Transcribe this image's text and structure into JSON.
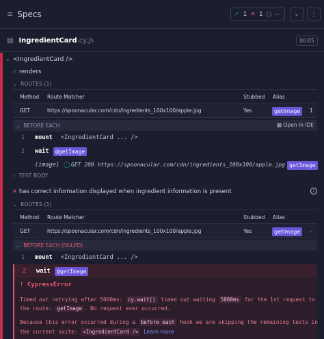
{
  "header": {
    "title": "Specs",
    "stats": {
      "passed": "1",
      "failed": "1",
      "pending": "--"
    }
  },
  "file": {
    "name": "IngredientCard",
    "ext": ".cy.js",
    "duration": "00:05"
  },
  "suite": {
    "title": "<IngredientCard />"
  },
  "test1": {
    "title": "renders",
    "routes_header": "ROUTES (1)",
    "routes_columns": {
      "method": "Method",
      "matcher": "Route Matcher",
      "stubbed": "Stubbed",
      "alias": "Alias"
    },
    "route": {
      "method": "GET",
      "matcher": "https://spoonacular.com/cdn/ingredients_100x100/apple.jpg",
      "stubbed": "Yes",
      "alias": "getImage",
      "count": "1"
    },
    "before_each_header": "BEFORE EACH",
    "open_in_ide": "Open in IDE",
    "commands": [
      {
        "idx": "1",
        "name": "mount",
        "msg": "<IngredientCard ... />"
      },
      {
        "idx": "2",
        "name": "wait",
        "alias": "@getImage"
      }
    ],
    "image_log": {
      "label": "(image)",
      "msg": "GET 200 https://spoonacular.com/cdn/ingredients_100x100/apple.jpg",
      "alias": "getImage"
    },
    "test_body_header": "TEST BODY"
  },
  "test2": {
    "title": "has correct information displayed when ingredient information is present",
    "routes_header": "ROUTES (1)",
    "routes_columns": {
      "method": "Method",
      "matcher": "Route Matcher",
      "stubbed": "Stubbed",
      "alias": "Alias"
    },
    "route": {
      "method": "GET",
      "matcher": "https://spoonacular.com/cdn/ingredients_100x100/apple.jpg",
      "stubbed": "Yes",
      "alias": "getImage",
      "count": "-"
    },
    "before_each_header": "BEFORE EACH (FAILED)",
    "commands": [
      {
        "idx": "1",
        "name": "mount",
        "msg": "<IngredientCard ... />"
      },
      {
        "idx": "2",
        "name": "wait",
        "alias": "@getImage"
      }
    ]
  },
  "error": {
    "title": "CypressError",
    "line1_pre": "Timed out retrying after 5000ms:",
    "line1_code1": "cy.wait()",
    "line1_mid": "timed out waiting",
    "line1_code2": "5000ms",
    "line1_post": "for the 1st request to",
    "line2_pre": "the route:",
    "line2_code": "getImage",
    "line2_post": ". No request ever occurred.",
    "line3_pre": "Because this error occurred during a",
    "line3_code": "before each",
    "line3_post": "hook we are skipping the remaining tests in",
    "line4_pre": "the current suite:",
    "line4_code": "<IngredientCard />",
    "learn_more": "Learn more"
  }
}
